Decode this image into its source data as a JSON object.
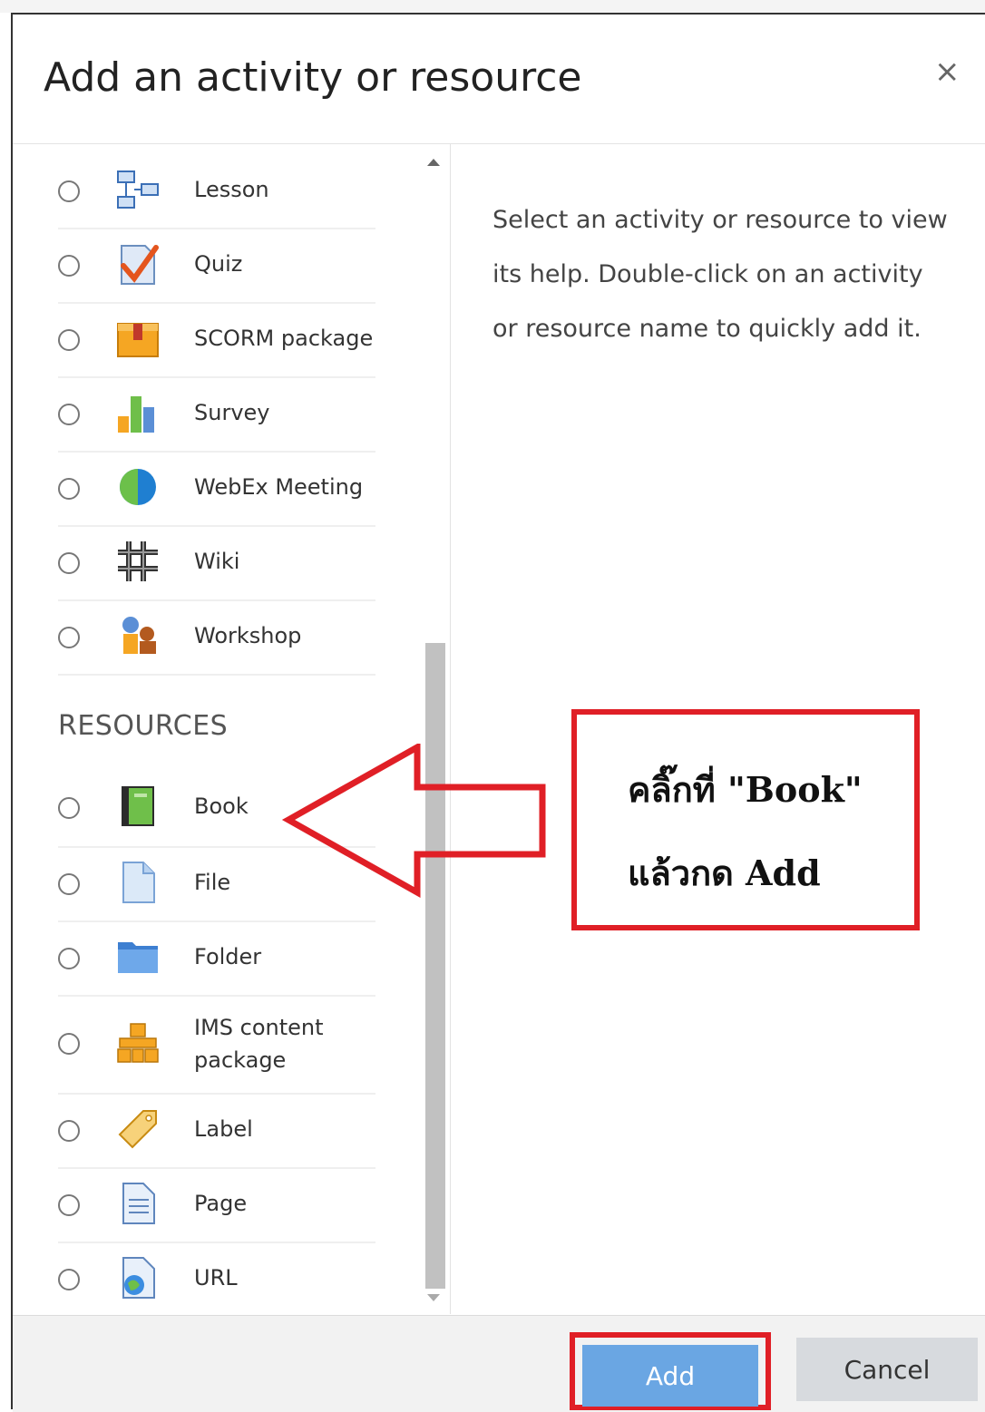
{
  "dialog": {
    "title": "Add an activity or resource",
    "close_glyph": "×"
  },
  "activities": [
    {
      "label": "Lesson",
      "icon": "lesson-icon"
    },
    {
      "label": "Quiz",
      "icon": "quiz-icon"
    },
    {
      "label": "SCORM package",
      "icon": "scorm-package-icon"
    },
    {
      "label": "Survey",
      "icon": "survey-icon"
    },
    {
      "label": "WebEx Meeting",
      "icon": "webex-meeting-icon"
    },
    {
      "label": "Wiki",
      "icon": "wiki-icon"
    },
    {
      "label": "Workshop",
      "icon": "workshop-icon"
    }
  ],
  "resources_header": "RESOURCES",
  "resources": [
    {
      "label": "Book",
      "icon": "book-icon"
    },
    {
      "label": "File",
      "icon": "file-icon"
    },
    {
      "label": "Folder",
      "icon": "folder-icon"
    },
    {
      "label_line1": "IMS content",
      "label_line2": "package",
      "icon": "ims-content-package-icon"
    },
    {
      "label": "Label",
      "icon": "label-tag-icon"
    },
    {
      "label": "Page",
      "icon": "page-icon"
    },
    {
      "label": "URL",
      "icon": "url-icon"
    }
  ],
  "help": {
    "text": "Select an activity or resource to view its help. Double-click on an activity or resource name to quickly add it."
  },
  "annotation": {
    "line1": "คลิ๊กที่ \"Book\"",
    "line2": "แล้วกด Add",
    "color": "#e01f26"
  },
  "footer": {
    "add_label": "Add",
    "cancel_label": "Cancel",
    "add_color": "#6aa6e3"
  }
}
